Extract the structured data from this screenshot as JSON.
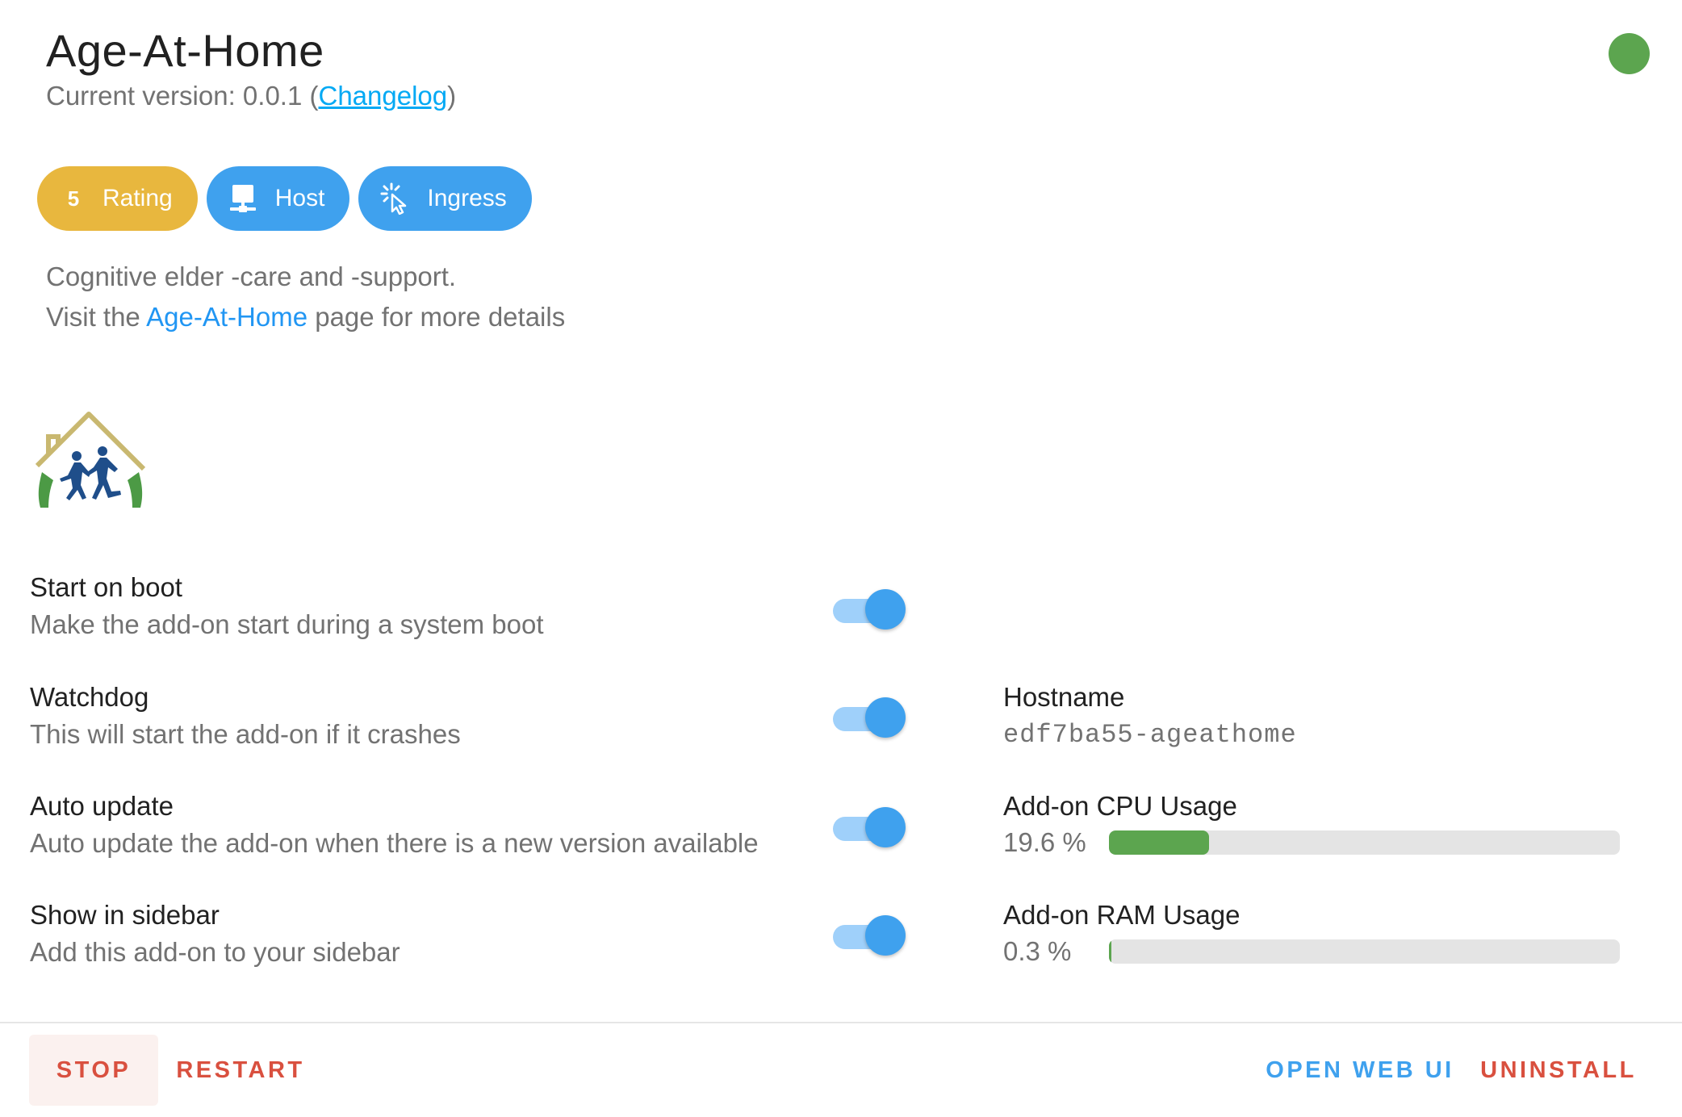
{
  "addon": {
    "name": "Age-At-Home",
    "version_prefix": "Current version: 0.0.1 (",
    "changelog_label": "Changelog",
    "version_suffix": ")",
    "status_color": "#5ca54f"
  },
  "chips": {
    "rating_value": "5",
    "rating_label": "Rating",
    "host_label": "Host",
    "host_icon": "network-host-icon",
    "ingress_label": "Ingress",
    "ingress_icon": "cursor-click-icon"
  },
  "description": {
    "line1": "Cognitive elder -care and -support.",
    "line2_prefix": "Visit the ",
    "line2_link": "Age-At-Home",
    "line2_suffix": " page for more details"
  },
  "logo_icon": "age-at-home-logo",
  "options": [
    {
      "title": "Start on boot",
      "desc": "Make the add-on start during a system boot",
      "enabled": true
    },
    {
      "title": "Watchdog",
      "desc": "This will start the add-on if it crashes",
      "enabled": true
    },
    {
      "title": "Auto update",
      "desc": "Auto update the add-on when there is a new version available",
      "enabled": true
    },
    {
      "title": "Show in sidebar",
      "desc": "Add this add-on to your sidebar",
      "enabled": true
    }
  ],
  "info": {
    "hostname_label": "Hostname",
    "hostname_value": "edf7ba55-ageathome",
    "cpu_label": "Add-on CPU Usage",
    "cpu_value": "19.6 %",
    "cpu_percent": 19.6,
    "ram_label": "Add-on RAM Usage",
    "ram_value": "0.3 %",
    "ram_percent": 0.3,
    "bar_color": "#5ca54f"
  },
  "actions": {
    "stop": "STOP",
    "restart": "RESTART",
    "open_web_ui": "OPEN WEB UI",
    "uninstall": "UNINSTALL"
  },
  "colors": {
    "accent_blue": "#3fa1ee",
    "rating_yellow": "#e8b73e",
    "danger_red": "#d9503f"
  }
}
